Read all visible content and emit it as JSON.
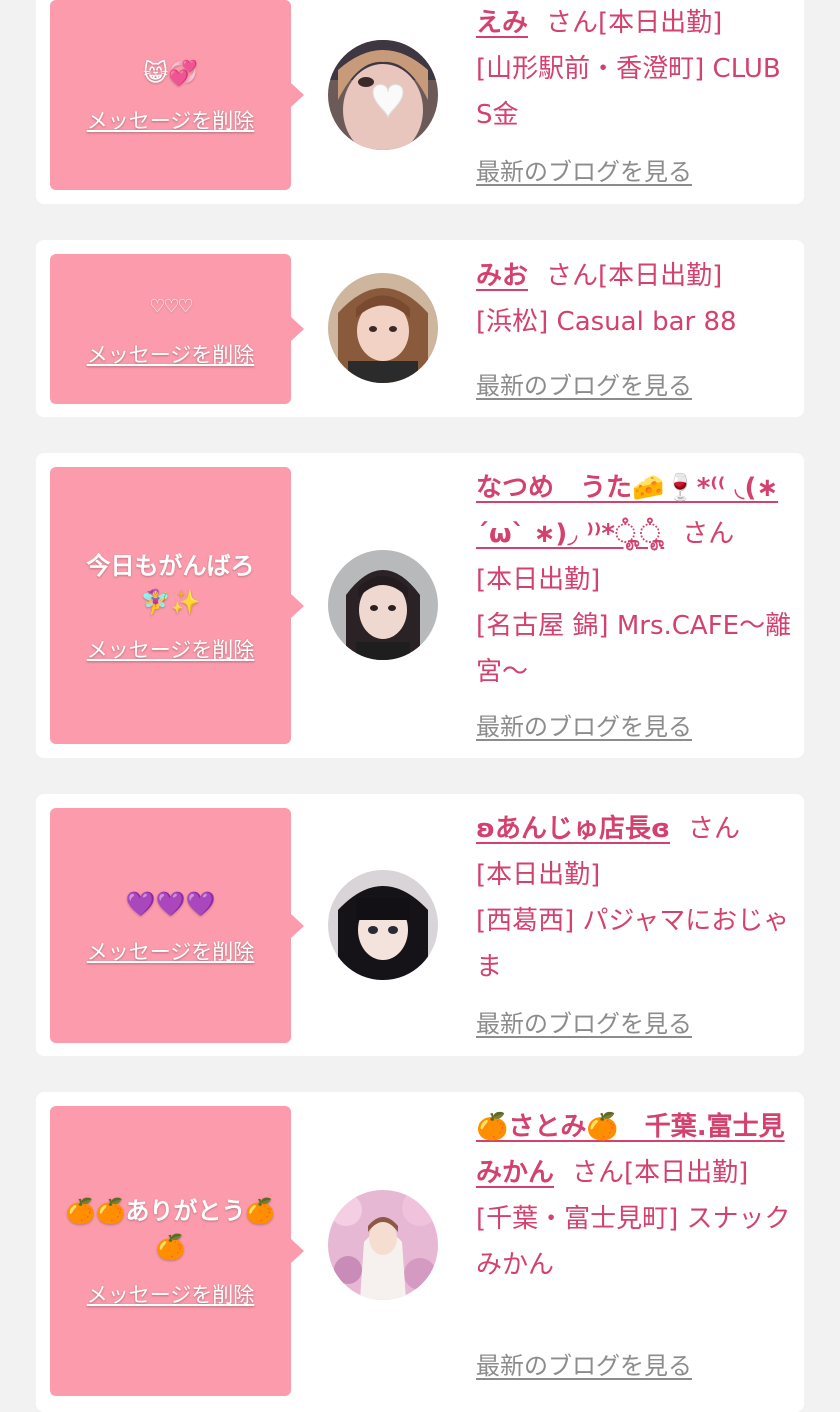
{
  "colors": {
    "page_background": "#f2f2f2",
    "card_background": "#ffffff",
    "bubble_pink": "#fb9bab",
    "name_text": "#d3426e",
    "blog_link": "#8c8c8c"
  },
  "common": {
    "delete_label": "メッセージを削除",
    "san_label": "さん",
    "blog_label": "最新のブログを見る"
  },
  "cards": [
    {
      "message": "😸💞",
      "name": "えみ",
      "line1": "[本日出勤]",
      "shop_line": "[山形駅前・香澄町] CLUB S金",
      "avatar_icon": "girl-photo-heart-sticker"
    },
    {
      "message": "♡♡♡",
      "name": "みお",
      "line1": "[本日出勤]",
      "shop_line": "[浜松] Casual bar 88",
      "avatar_icon": "girl-photo-brown-hair"
    },
    {
      "message": "今日もがんばろ🧚‍♀️✨",
      "name": "なつめ　うた🧀🍷*⁽⁽ ◟(∗ ˊωˋ ∗)◞ ⁾⁾*ೄ̊ೄ̊",
      "line1": "[本日出勤]",
      "shop_line": "[名古屋 錦] Mrs.CAFE〜離宮〜",
      "avatar_icon": "girl-photo-dark-hair"
    },
    {
      "message": "💜💜💜",
      "name": "ʚあんじゅ店長ɞ",
      "line1": "[本日出勤]",
      "shop_line": "[西葛西] パジャマにおじゃま",
      "avatar_icon": "girl-photo-black-hair"
    },
    {
      "message": "🍊🍊ありがとう🍊🍊",
      "name": "🍊さとみ🍊　千葉.富士見みかん",
      "line1": "[本日出勤]",
      "shop_line": "[千葉・富士見町] スナックみかん",
      "avatar_icon": "girl-photo-cherry-blossom"
    }
  ]
}
